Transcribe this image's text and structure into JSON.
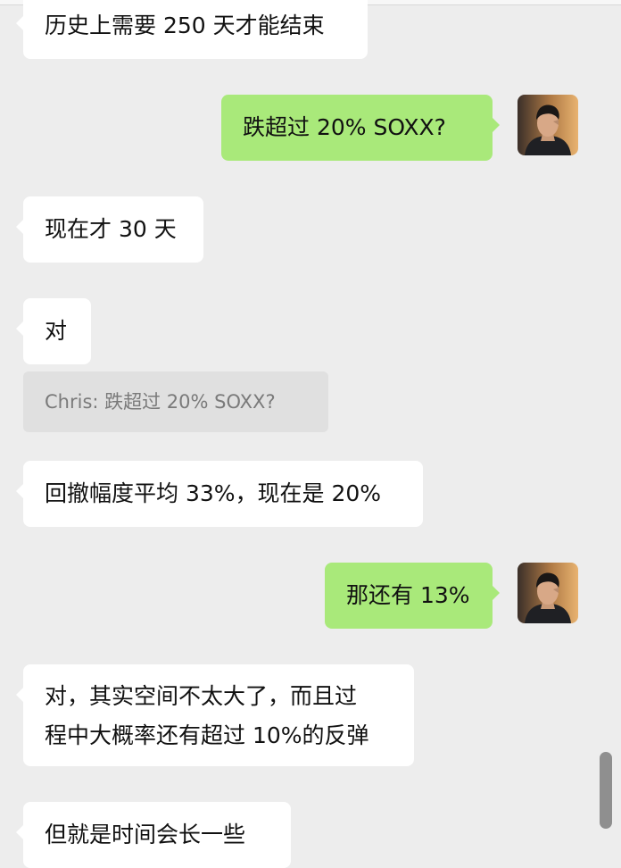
{
  "chat": {
    "messages": [
      {
        "id": "m1",
        "side": "in",
        "text": "历史上需要 250 天才能结束"
      },
      {
        "id": "m2",
        "side": "out",
        "text": "跌超过 20% SOXX?"
      },
      {
        "id": "m3",
        "side": "in",
        "text": "现在才 30 天"
      },
      {
        "id": "m4",
        "side": "in",
        "text": "对"
      },
      {
        "id": "q1",
        "type": "quote",
        "text": "Chris: 跌超过 20% SOXX?"
      },
      {
        "id": "m5",
        "side": "in",
        "text": "回撤幅度平均 33%，现在是 20%"
      },
      {
        "id": "m6",
        "side": "out",
        "text": "那还有 13%"
      },
      {
        "id": "m7",
        "side": "in",
        "lines": [
          "对，其实空间不太大了，而且过",
          "程中大概率还有超过 10%的反弹"
        ]
      },
      {
        "id": "m8",
        "side": "in",
        "text": "但就是时间会长一些"
      }
    ]
  },
  "colors": {
    "background": "#ededed",
    "incoming_bubble": "#ffffff",
    "outgoing_bubble": "#a9e97a",
    "quote_bg": "#e0e0e0",
    "quote_text": "#7a7a7a"
  }
}
